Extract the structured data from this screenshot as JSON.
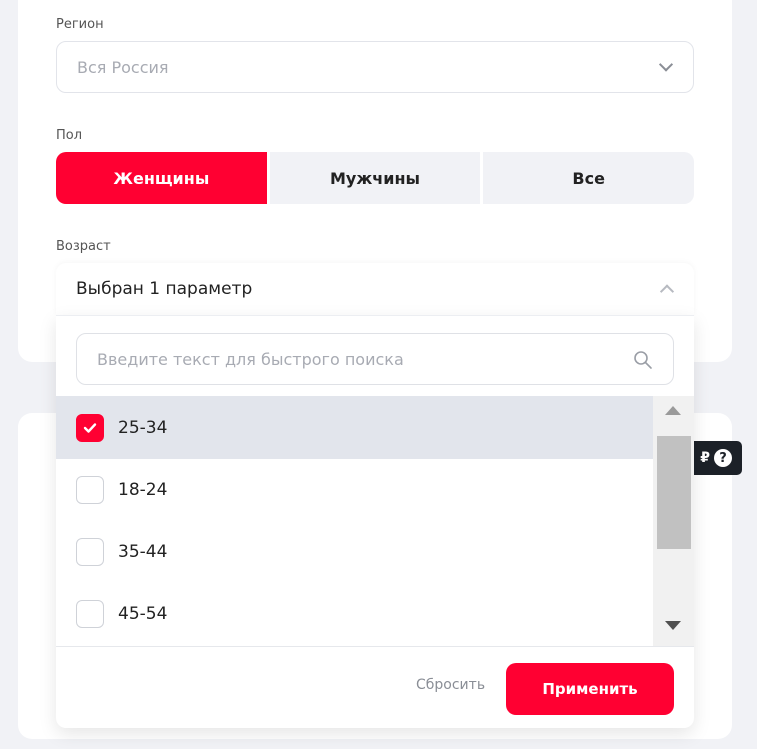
{
  "region": {
    "label": "Регион",
    "placeholder": "Вся Россия"
  },
  "gender": {
    "label": "Пол",
    "options": [
      "Женщины",
      "Мужчины",
      "Все"
    ],
    "selected": "Женщины"
  },
  "age": {
    "label": "Возраст",
    "summary": "Выбран 1 параметр",
    "search_placeholder": "Введите текст для быстрого поиска",
    "options": [
      {
        "label": "25-34",
        "checked": true
      },
      {
        "label": "18-24",
        "checked": false
      },
      {
        "label": "35-44",
        "checked": false
      },
      {
        "label": "45-54",
        "checked": false
      }
    ],
    "reset_label": "Сбросить",
    "apply_label": "Применить"
  },
  "tooltip": {
    "currency": "₽",
    "help": "?"
  },
  "colors": {
    "accent": "#ff0032",
    "selected_row": "#e2e5ec",
    "background": "#f1f2f6"
  }
}
